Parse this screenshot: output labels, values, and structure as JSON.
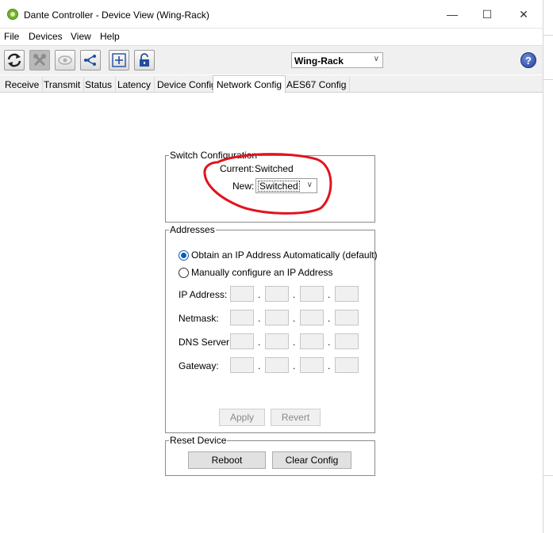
{
  "window": {
    "title": "Dante Controller - Device View (Wing-Rack)",
    "minimize_glyph": "—",
    "maximize_glyph": "☐",
    "close_glyph": "✕"
  },
  "menu": [
    "File",
    "Devices",
    "View",
    "Help"
  ],
  "toolbar": {
    "buttons": [
      "refresh-icon",
      "tools-icon",
      "eye-icon",
      "share-icon",
      "add-icon",
      "unlock-icon"
    ],
    "device_selected": "Wing-Rack",
    "help_label": "?"
  },
  "tabs": [
    "Receive",
    "Transmit",
    "Status",
    "Latency",
    "Device Config",
    "Network Config",
    "AES67 Config"
  ],
  "active_tab": "Network Config",
  "switch_config": {
    "title": "Switch Configuration",
    "current_label": "Current:",
    "current_value": "Switched",
    "new_label": "New:",
    "new_value": "Switched"
  },
  "addresses": {
    "title": "Addresses",
    "options": [
      {
        "label": "Obtain an IP Address Automatically (default)",
        "selected": true
      },
      {
        "label": "Manually configure an IP Address",
        "selected": false
      }
    ],
    "fields": [
      "IP Address:",
      "Netmask:",
      "DNS Server:",
      "Gateway:"
    ],
    "apply_label": "Apply",
    "revert_label": "Revert"
  },
  "reset_device": {
    "title": "Reset Device",
    "reboot_label": "Reboot",
    "clear_config_label": "Clear Config"
  },
  "colors": {
    "annotation": "#e0141e",
    "radio_selected": "#0a5cb8",
    "app_icon": "#6fb12f"
  }
}
